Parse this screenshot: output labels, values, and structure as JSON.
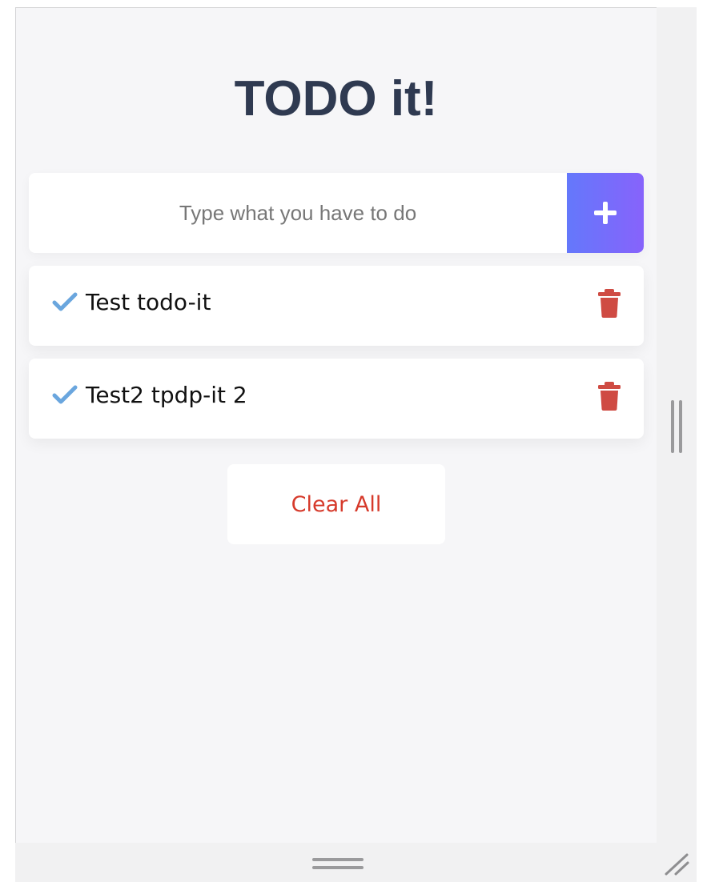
{
  "app": {
    "title": "TODO it!"
  },
  "input": {
    "value": "",
    "placeholder": "Type what you have to do"
  },
  "add_button": {
    "icon": "plus-icon"
  },
  "todos": [
    {
      "text": "Test todo-it",
      "check_icon": "checkmark-icon",
      "delete_icon": "trash-icon"
    },
    {
      "text": "Test2 tpdp-it 2",
      "check_icon": "checkmark-icon",
      "delete_icon": "trash-icon"
    }
  ],
  "clear_button": {
    "label": "Clear All"
  },
  "colors": {
    "title": "#2f3a51",
    "accent_start": "#6478fb",
    "accent_end": "#8763fb",
    "check": "#6aa6de",
    "trash": "#cf4b43",
    "clear_text": "#d63a2b",
    "background": "#f6f6f8"
  }
}
